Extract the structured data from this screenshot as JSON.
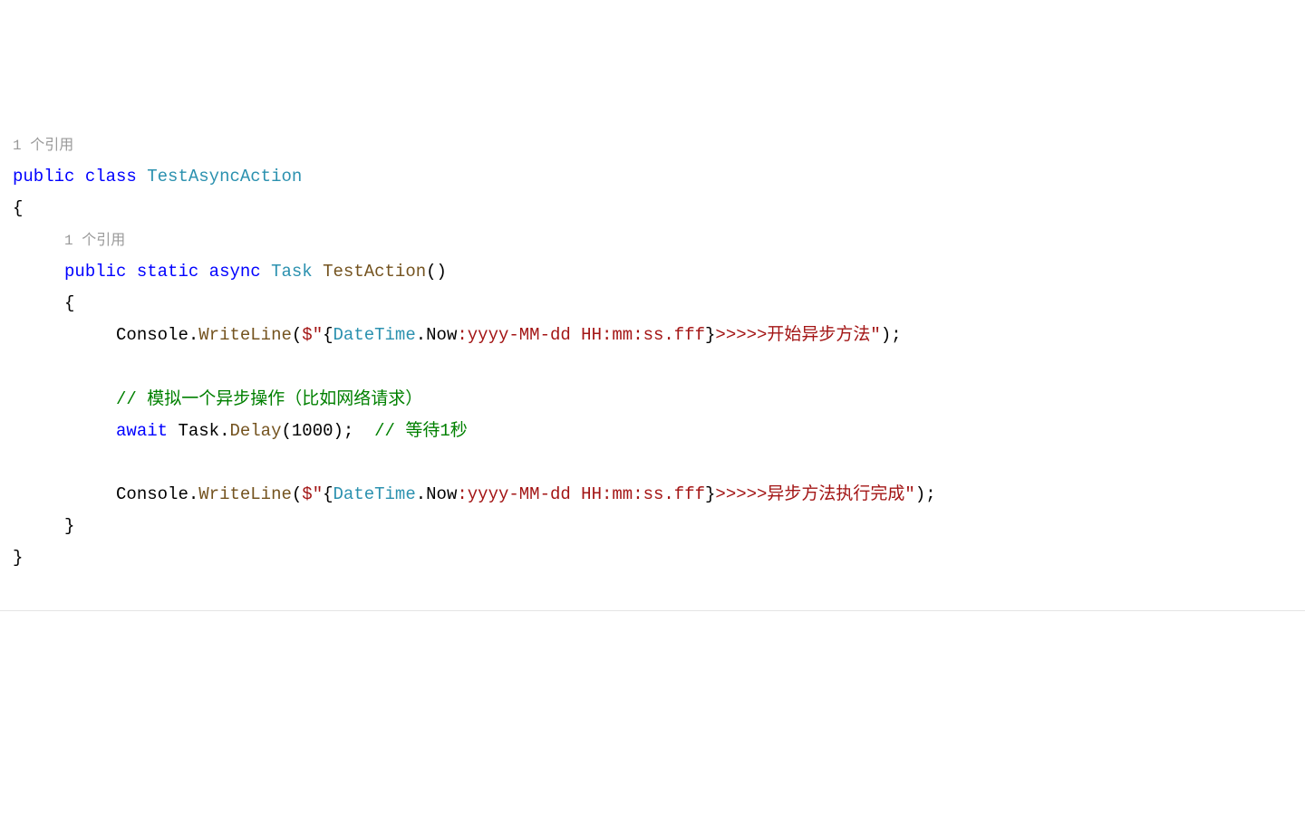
{
  "codelens": {
    "class_ref": "1 个引用",
    "method_ref": "1 个引用"
  },
  "keywords": {
    "public": "public",
    "class": "class",
    "static": "static",
    "async": "async",
    "await": "await"
  },
  "types": {
    "class_name": "TestAsyncAction",
    "task": "Task",
    "datetime": "DateTime"
  },
  "methods": {
    "test_action": "TestAction",
    "writeline": "WriteLine",
    "delay": "Delay",
    "now": "Now"
  },
  "identifiers": {
    "console": "Console",
    "taskid": "Task"
  },
  "strings": {
    "interp_start": "$\"",
    "format_str1": ":yyyy-MM-dd HH:mm:ss.fff",
    "start_msg": ">>>>>开始异步方法\"",
    "end_msg": ">>>>>异步方法执行完成\""
  },
  "comments": {
    "simulate": "// 模拟一个异步操作（比如网络请求）",
    "wait": "// 等待1秒"
  },
  "punct": {
    "open_brace": "{",
    "close_brace": "}",
    "open_paren": "(",
    "close_paren": ")",
    "semicolon": ";",
    "dot": ".",
    "num1000": "1000",
    "close_paren_semi": ");",
    "empty_parens": "()"
  }
}
